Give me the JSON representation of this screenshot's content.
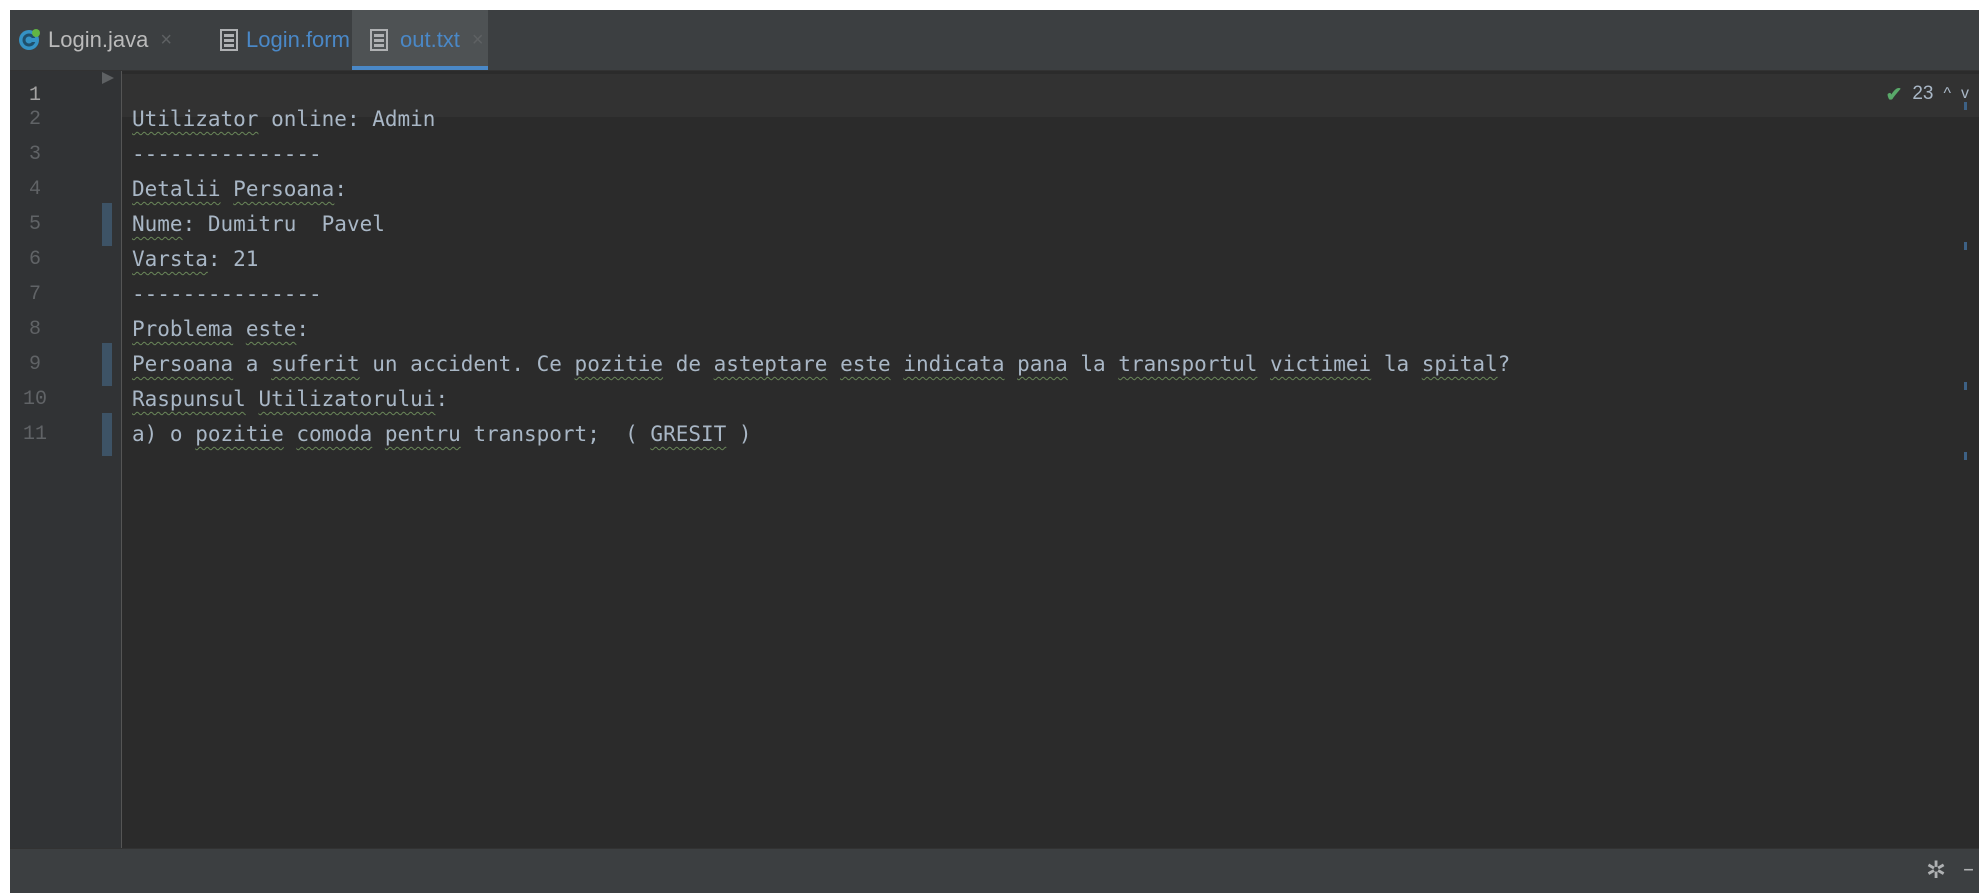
{
  "tabs": [
    {
      "label": "Login.java",
      "icon": "java-class-icon",
      "active": false
    },
    {
      "label": "Login.form",
      "icon": "form-file-icon",
      "active": false
    },
    {
      "label": "out.txt",
      "icon": "text-file-icon",
      "active": true
    }
  ],
  "tab_close_glyph": "×",
  "line_numbers": [
    "1",
    "2",
    "3",
    "4",
    "5",
    "6",
    "7",
    "8",
    "9",
    "10",
    "11"
  ],
  "inspection": {
    "count": "23",
    "check_glyph": "✔",
    "up_glyph": "^",
    "down_glyph": "v"
  },
  "lines": [
    "",
    "Utilizator online: Admin",
    "---------------",
    "Detalii Persoana:",
    "Nume: Dumitru  Pavel",
    "Varsta: 21",
    "---------------",
    "Problema este:",
    "Persoana a suferit un accident. Ce pozitie de asteptare este indicata pana la transportul victimei la spital?",
    "Raspunsul Utilizatorului:",
    "a) o pozitie comoda pentru transport;  ( GRESIT )"
  ],
  "bottom_bar": {
    "gear_glyph": "✲",
    "minimize_glyph": "–"
  },
  "colors": {
    "editor_bg": "#2b2b2b",
    "gutter_bg": "#313335",
    "text": "#a9b7c6",
    "tab_underline": "#4a88c7",
    "typo_underline": "#6a8759",
    "check": "#59a869"
  }
}
